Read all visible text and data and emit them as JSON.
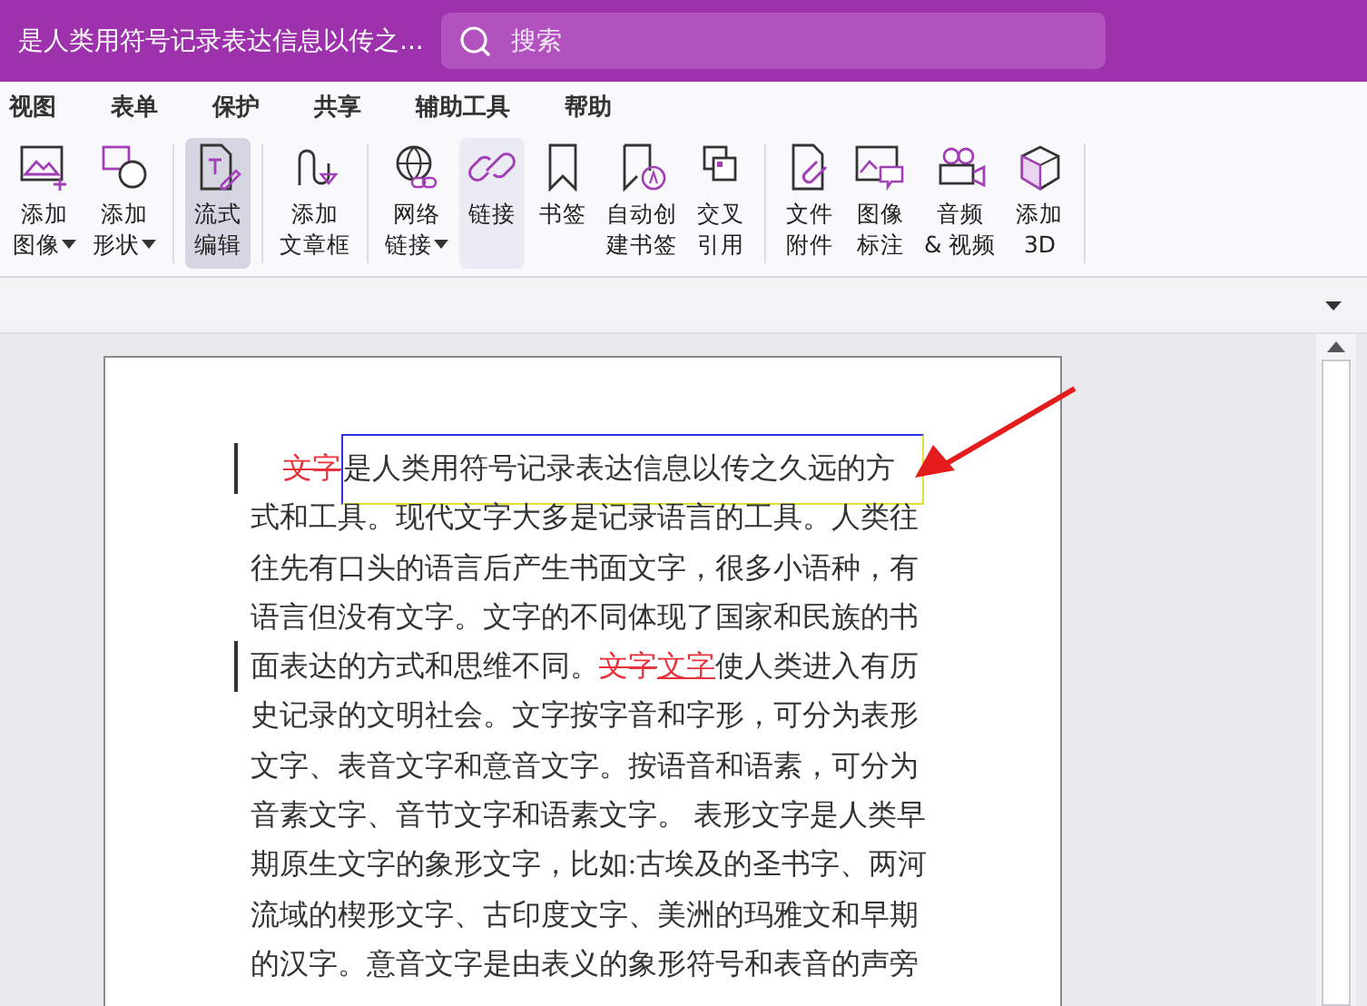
{
  "window": {
    "title": "是人类用符号记录表达信息以传之..."
  },
  "search": {
    "placeholder": "搜索"
  },
  "menu_tabs": [
    {
      "label": "视图"
    },
    {
      "label": "表单"
    },
    {
      "label": "保护"
    },
    {
      "label": "共享"
    },
    {
      "label": "辅助工具"
    },
    {
      "label": "帮助"
    }
  ],
  "ribbon_groups": [
    [
      {
        "lines": [
          "添加",
          "图像"
        ],
        "dropdown": true,
        "kind": "normal"
      },
      {
        "lines": [
          "添加",
          "形状"
        ],
        "dropdown": true,
        "kind": "normal"
      }
    ],
    [
      {
        "lines": [
          "流式",
          "编辑"
        ],
        "dropdown": false,
        "kind": "active"
      }
    ],
    [
      {
        "lines": [
          "添加",
          "文章框"
        ],
        "dropdown": false,
        "kind": "normal"
      }
    ],
    [
      {
        "lines": [
          "网络",
          "链接"
        ],
        "dropdown": true,
        "kind": "normal"
      },
      {
        "lines": [
          "链接"
        ],
        "dropdown": false,
        "kind": "hover"
      },
      {
        "lines": [
          "书签"
        ],
        "dropdown": false,
        "kind": "normal"
      },
      {
        "lines": [
          "自动创",
          "建书签"
        ],
        "dropdown": false,
        "kind": "normal"
      },
      {
        "lines": [
          "交叉",
          "引用"
        ],
        "dropdown": false,
        "kind": "normal"
      }
    ],
    [
      {
        "lines": [
          "文件",
          "附件"
        ],
        "dropdown": false,
        "kind": "normal"
      },
      {
        "lines": [
          "图像",
          "标注"
        ],
        "dropdown": false,
        "kind": "normal"
      },
      {
        "lines": [
          "音频",
          "& 视频"
        ],
        "dropdown": false,
        "kind": "normal"
      },
      {
        "lines": [
          "添加",
          "3D"
        ],
        "dropdown": false,
        "kind": "normal"
      }
    ]
  ],
  "document": {
    "lines": [
      {
        "changed": true,
        "segments": [
          {
            "kind": "deleted",
            "text": "文字"
          },
          {
            "kind": "selected",
            "text": "是人类用符号记录表达信息以传之久远的方"
          }
        ]
      },
      {
        "changed": false,
        "segments": [
          {
            "kind": "normal",
            "text": "式和工具。现代文字大多是记录语言的工具。人类往"
          }
        ]
      },
      {
        "changed": false,
        "segments": [
          {
            "kind": "normal",
            "text": "往先有口头的语言后产生书面文字，很多小语种，有"
          }
        ]
      },
      {
        "changed": false,
        "segments": [
          {
            "kind": "normal",
            "text": "语言但没有文字。文字的不同体现了国家和民族的书"
          }
        ]
      },
      {
        "changed": true,
        "segments": [
          {
            "kind": "normal",
            "text": "面表达的方式和思维不同。"
          },
          {
            "kind": "deleted",
            "text": "文字"
          },
          {
            "kind": "inserted",
            "text": "文字"
          },
          {
            "kind": "normal",
            "text": "使人类进入有历"
          }
        ]
      },
      {
        "changed": false,
        "segments": [
          {
            "kind": "normal",
            "text": "史记录的文明社会。文字按字音和字形，可分为表形"
          }
        ]
      },
      {
        "changed": false,
        "segments": [
          {
            "kind": "normal",
            "text": "文字、表音文字和意音文字。按语音和语素，可分为"
          }
        ]
      },
      {
        "changed": false,
        "segments": [
          {
            "kind": "normal",
            "text": "音素文字、音节文字和语素文字。 表形文字是人类早"
          }
        ]
      },
      {
        "changed": false,
        "segments": [
          {
            "kind": "normal",
            "text": "期原生文字的象形文字，比如:古埃及的圣书字、两河"
          }
        ]
      },
      {
        "changed": false,
        "segments": [
          {
            "kind": "normal",
            "text": "流域的楔形文字、古印度文字、美洲的玛雅文和早期"
          }
        ]
      },
      {
        "changed": false,
        "segments": [
          {
            "kind": "normal",
            "text": "的汉字。意音文字是由表义的象形符号和表音的声旁"
          }
        ]
      }
    ]
  }
}
